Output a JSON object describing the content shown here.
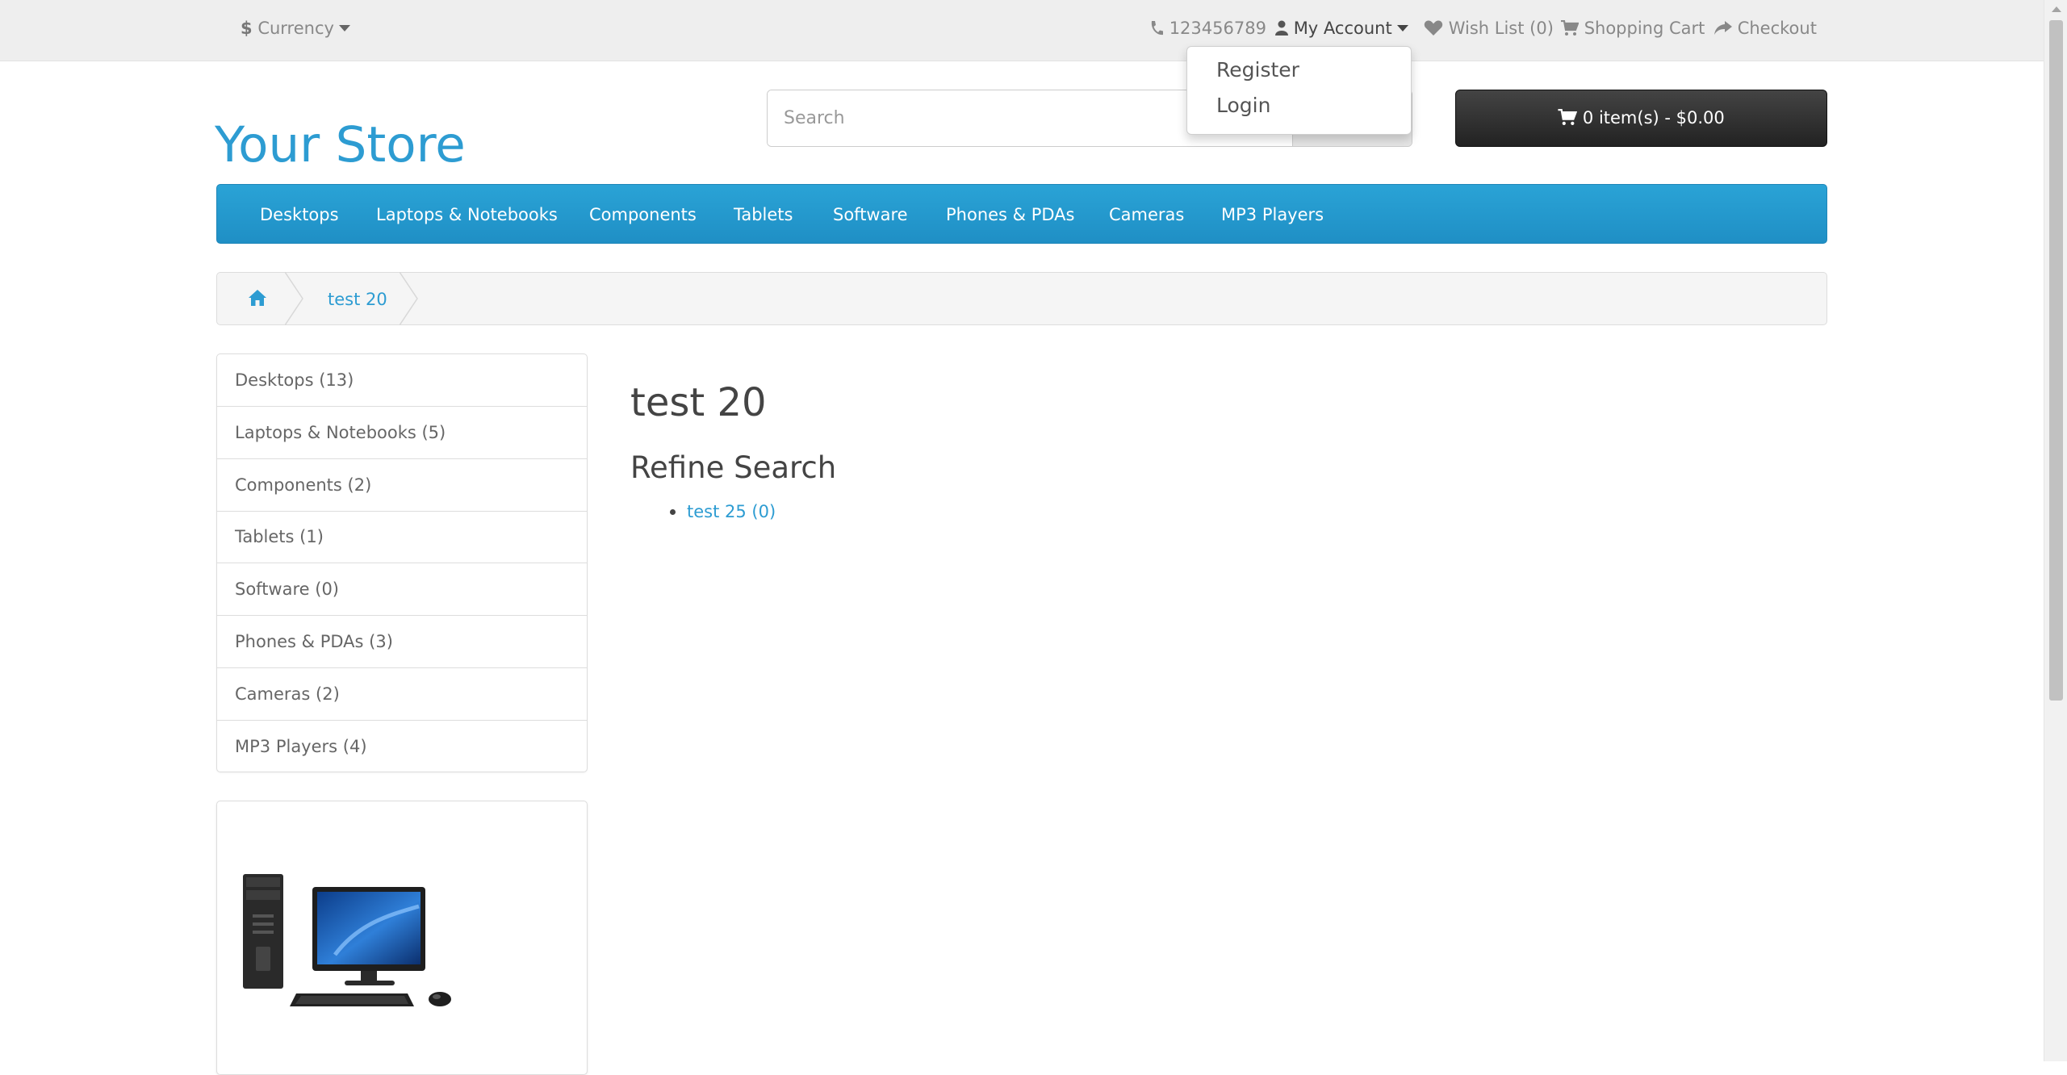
{
  "topbar": {
    "currency_label": "Currency",
    "phone": "123456789",
    "my_account": "My Account",
    "wishlist": "Wish List (0)",
    "shopping_cart": "Shopping Cart",
    "checkout": "Checkout"
  },
  "account_menu": {
    "items": [
      "Register",
      "Login"
    ]
  },
  "header": {
    "logo": "Your Store",
    "search_placeholder": "Search",
    "cart_button": "0 item(s) - $0.00"
  },
  "menu": {
    "items": [
      "Desktops",
      "Laptops & Notebooks",
      "Components",
      "Tablets",
      "Software",
      "Phones & PDAs",
      "Cameras",
      "MP3 Players"
    ]
  },
  "breadcrumb": {
    "current": "test 20"
  },
  "sidebar": {
    "categories": [
      "Desktops (13)",
      "Laptops & Notebooks (5)",
      "Components (2)",
      "Tablets (1)",
      "Software (0)",
      "Phones & PDAs (3)",
      "Cameras (2)",
      "MP3 Players (4)"
    ]
  },
  "content": {
    "title": "test 20",
    "refine_heading": "Refine Search",
    "refine_links": [
      "test 25 (0)"
    ]
  },
  "colors": {
    "brand_blue": "#2d9cd2",
    "menu_blue": "#229ad0",
    "cart_dark": "#333333"
  }
}
